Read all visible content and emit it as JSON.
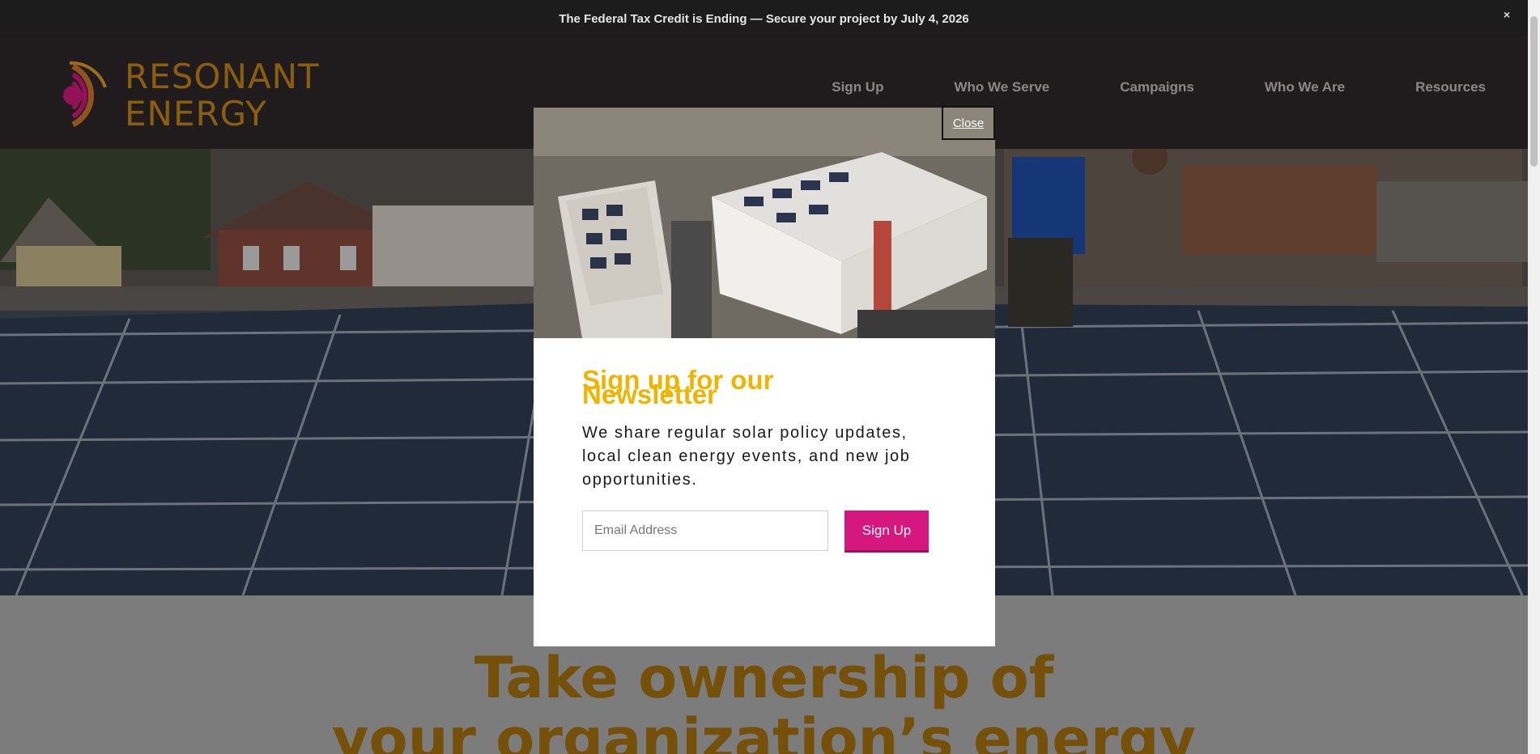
{
  "announcement": {
    "text": "The Federal Tax Credit is Ending — Secure your project by July 4, 2026",
    "close_label": "×"
  },
  "header": {
    "logo_line1": "RESONANT",
    "logo_line2": "ENERGY",
    "nav": [
      {
        "label": "Sign Up"
      },
      {
        "label": "Who We Serve"
      },
      {
        "label": "Campaigns"
      },
      {
        "label": "Who We Are"
      },
      {
        "label": "Resources"
      }
    ]
  },
  "headline": {
    "line1": "Take ownership of",
    "line2": "your organization’s energy"
  },
  "modal": {
    "close_label": "Close",
    "title": "Sign up for our Newsletter",
    "description": "We share regular solar policy updates, local clean energy events, and new job opportunities.",
    "email_placeholder": "Email Address",
    "button_label": "Sign Up"
  },
  "colors": {
    "brand_orange": "#c78710",
    "accent_magenta": "#d4187e",
    "modal_title_yellow": "#f0b400",
    "header_bg": "#2e292a"
  }
}
